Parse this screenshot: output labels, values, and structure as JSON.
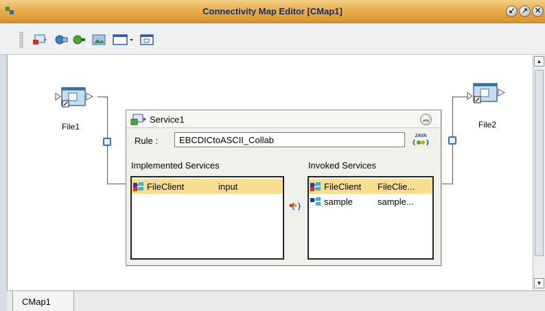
{
  "window": {
    "title": "Connectivity Map Editor [CMap1]",
    "controls": [
      "restore",
      "maximize",
      "close"
    ]
  },
  "toolbar": {
    "icons": [
      "add-service-icon",
      "add-connector-icon",
      "add-adapter-icon",
      "add-image-icon",
      "view-menu-icon",
      "new-window-icon"
    ]
  },
  "external_systems": [
    {
      "label": "File1"
    },
    {
      "label": "File2"
    }
  ],
  "service": {
    "title": "Service1",
    "rule_label": "Rule :",
    "rule_value": "EBCDICtoASCII_Collab",
    "implemented_header": "Implemented Services",
    "invoked_header": "Invoked Services",
    "implemented": [
      {
        "name": "FileClient",
        "op": "input",
        "selected": true
      }
    ],
    "invoked": [
      {
        "name": "FileClient",
        "op": "FileClie...",
        "selected": true
      },
      {
        "name": "sample",
        "op": "sample...",
        "selected": false
      }
    ]
  },
  "tabs": [
    {
      "label": "CMap1"
    }
  ],
  "colors": {
    "titlebar": "#e7a844",
    "selection": "#fbdd8f",
    "connector": "#3a72b8"
  }
}
